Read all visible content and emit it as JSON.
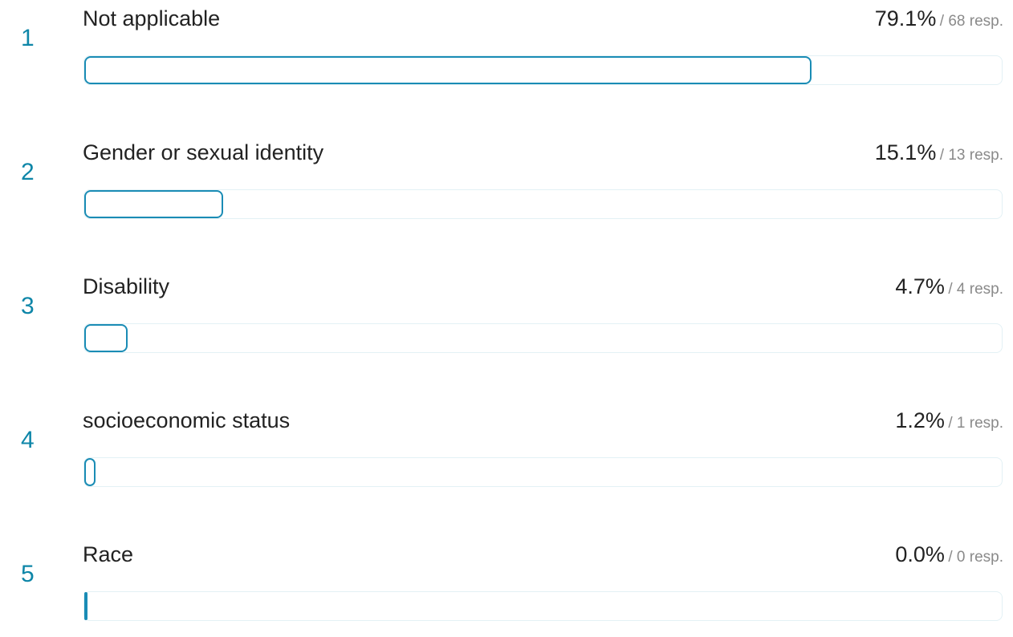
{
  "chart_data": {
    "type": "bar",
    "orientation": "horizontal",
    "xlim": [
      0,
      100
    ],
    "bar_color": "#1a8cb5",
    "rank_color": "#0e86a8",
    "track_border_color": "#e3f1f5",
    "items": [
      {
        "rank": "1",
        "label": "Not applicable",
        "percent_label": "79.1%",
        "responses_label": "/ 68 resp.",
        "value": 79.1,
        "responses": 68
      },
      {
        "rank": "2",
        "label": "Gender or sexual identity",
        "percent_label": "15.1%",
        "responses_label": "/ 13 resp.",
        "value": 15.1,
        "responses": 13
      },
      {
        "rank": "3",
        "label": "Disability",
        "percent_label": "4.7%",
        "responses_label": "/ 4 resp.",
        "value": 4.7,
        "responses": 4
      },
      {
        "rank": "4",
        "label": "socioeconomic status",
        "percent_label": "1.2%",
        "responses_label": "/ 1 resp.",
        "value": 1.2,
        "responses": 1
      },
      {
        "rank": "5",
        "label": "Race",
        "percent_label": "0.0%",
        "responses_label": "/ 0 resp.",
        "value": 0.0,
        "responses": 0
      }
    ]
  }
}
